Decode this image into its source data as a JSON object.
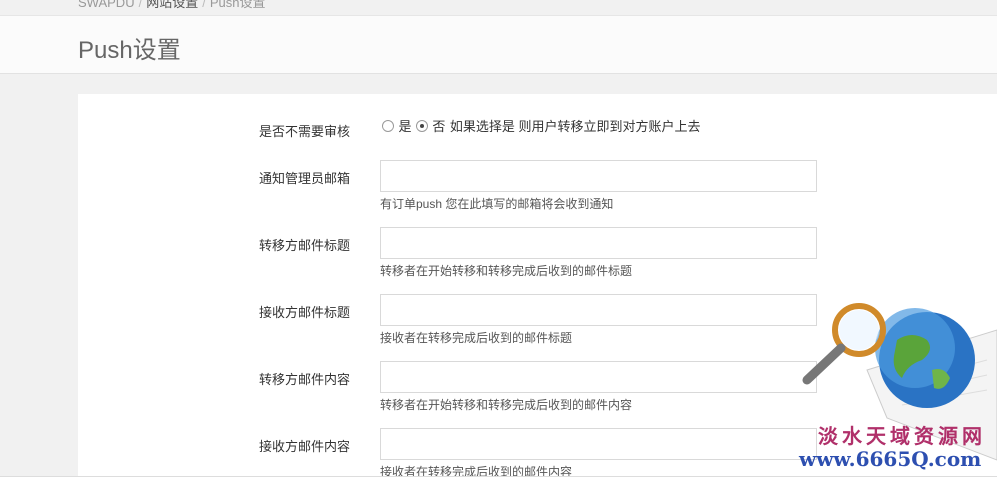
{
  "breadcrumb": {
    "root": "SWAPDU",
    "parent": "网站设置",
    "current": "Push设置"
  },
  "page": {
    "title": "Push设置"
  },
  "form": {
    "review": {
      "label": "是否不需要审核",
      "option_yes": "是",
      "option_no": "否",
      "selected": "否",
      "help": "如果选择是 则用户转移立即到对方账户上去"
    },
    "admin_email": {
      "label": "通知管理员邮箱",
      "value": "",
      "help": "有订单push 您在此填写的邮箱将会收到通知"
    },
    "sender_subject": {
      "label": "转移方邮件标题",
      "value": "",
      "help": "转移者在开始转移和转移完成后收到的邮件标题"
    },
    "receiver_subject": {
      "label": "接收方邮件标题",
      "value": "",
      "help": "接收者在转移完成后收到的邮件标题"
    },
    "sender_content": {
      "label": "转移方邮件内容",
      "value": "",
      "help": "转移者在开始转移和转移完成后收到的邮件内容"
    },
    "receiver_content": {
      "label": "接收方邮件内容",
      "value": "",
      "help": "接收者在转移完成后收到的邮件内容"
    }
  },
  "watermark": {
    "line1": "淡水天域资源网",
    "line2": "www.6665Q.com"
  }
}
